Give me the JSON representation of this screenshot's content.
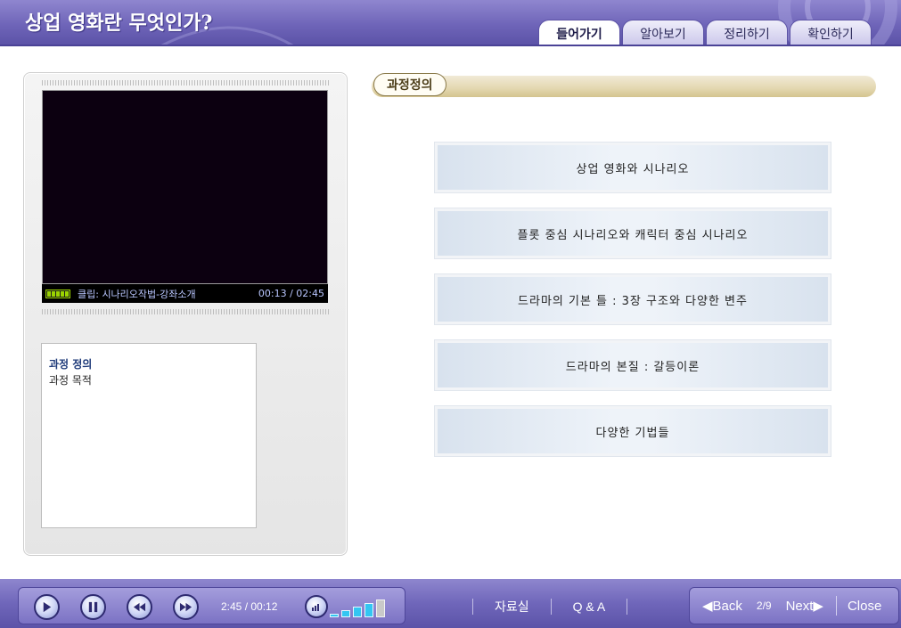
{
  "header": {
    "title": "상업 영화란 무엇인가?",
    "tabs": [
      {
        "label": "들어가기",
        "active": true
      },
      {
        "label": "알아보기",
        "active": false
      },
      {
        "label": "정리하기",
        "active": false
      },
      {
        "label": "확인하기",
        "active": false
      }
    ]
  },
  "player": {
    "clip_label": "클립: 시나리오작법-강좌소개",
    "clip_time": "00:13 / 02:45"
  },
  "outline": {
    "items": [
      {
        "label": "과정 정의",
        "active": true
      },
      {
        "label": "과정 목적",
        "active": false
      }
    ]
  },
  "main": {
    "section_label": "과정정의",
    "topics": [
      "상업 영화와 시나리오",
      "플롯 중심 시나리오와 캐릭터 중심 시나리오",
      "드라마의 기본 틀 : 3장 구조와 다양한 변주",
      "드라마의 본질 : 갈등이론",
      "다양한 기법들"
    ]
  },
  "controls": {
    "time_readout": "2:45 / 00:12",
    "icons": [
      "play-icon",
      "pause-icon",
      "rewind-icon",
      "fast-forward-icon",
      "volume-icon"
    ]
  },
  "links": {
    "resources": "자료실",
    "qa": "Q & A"
  },
  "pager": {
    "back_label": "◀Back",
    "page_indicator": "2/9",
    "next_label": "Next▶",
    "close_label": "Close"
  },
  "colors": {
    "header": "#6e64b8",
    "accent_blue": "#33c6f2",
    "video_bg": "#0c0010",
    "topic_bg": "#eef3f9"
  }
}
